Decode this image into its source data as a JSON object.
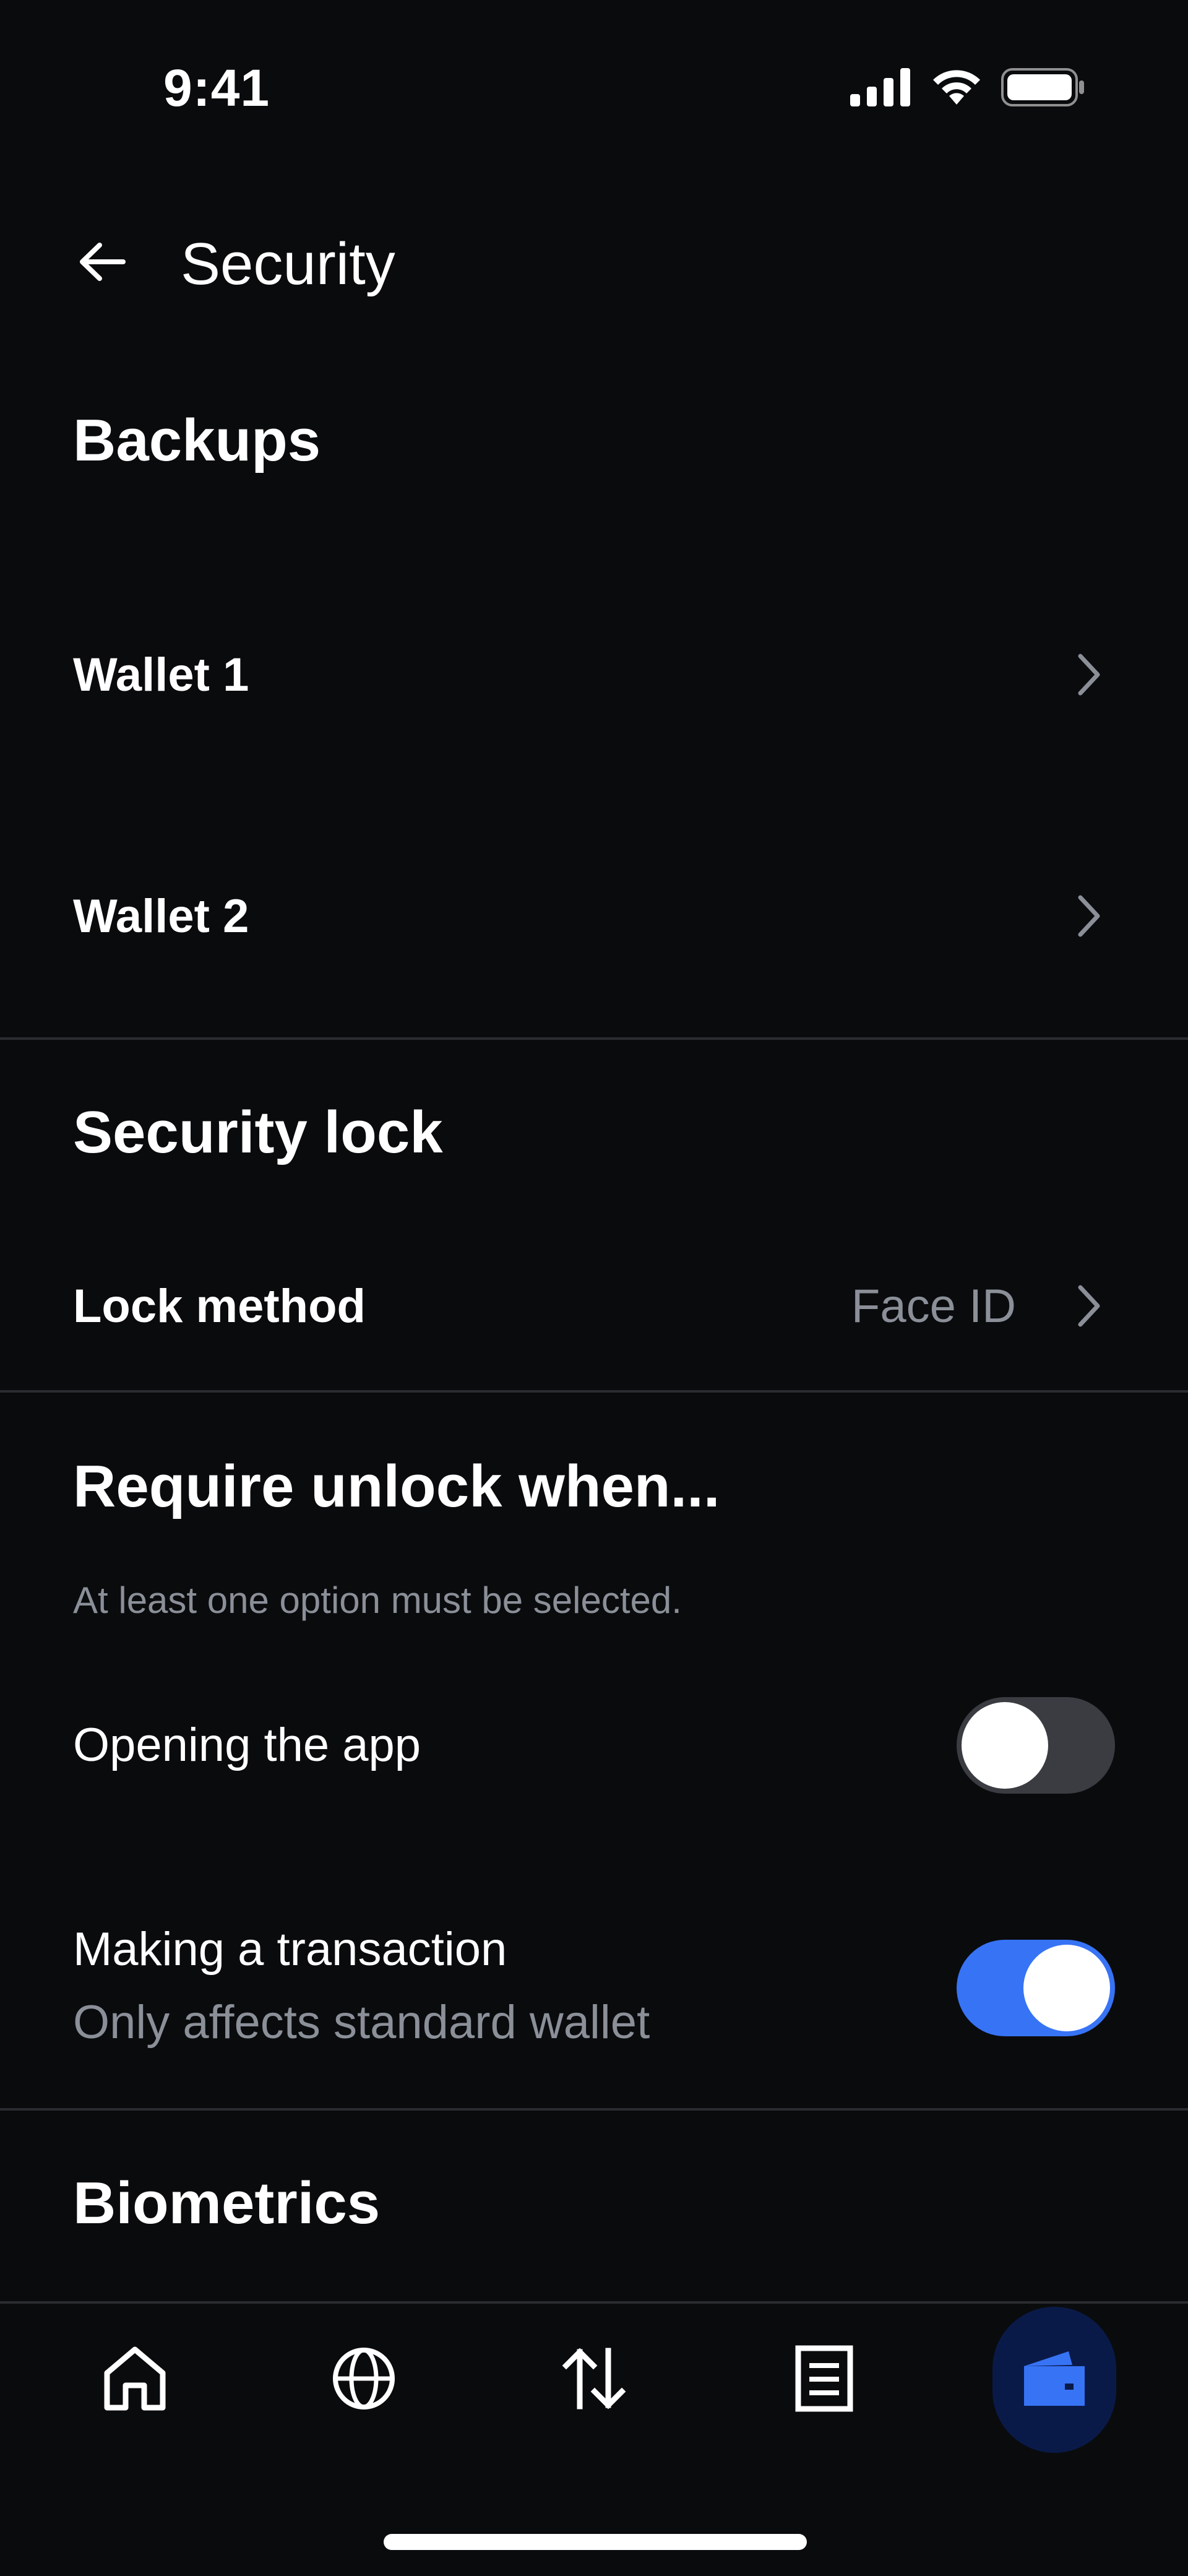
{
  "status_bar": {
    "time": "9:41"
  },
  "header": {
    "title": "Security"
  },
  "backups": {
    "title": "Backups",
    "items": [
      {
        "label": "Wallet 1"
      },
      {
        "label": "Wallet 2"
      }
    ]
  },
  "security_lock": {
    "title": "Security lock",
    "lock_method_label": "Lock method",
    "lock_method_value": "Face ID"
  },
  "require_unlock": {
    "title": "Require unlock when...",
    "helper": "At least one option must be selected.",
    "options": [
      {
        "label": "Opening the app",
        "enabled": false
      },
      {
        "label": "Making a transaction",
        "sublabel": "Only affects standard wallet",
        "enabled": true
      }
    ]
  },
  "biometrics": {
    "title": "Biometrics"
  },
  "bottom_nav": {
    "items": [
      "home-icon",
      "globe-icon",
      "transfer-icon",
      "document-icon",
      "wallet-icon"
    ],
    "active": "wallet-icon"
  },
  "colors": {
    "background": "#0a0b0d",
    "accent": "#3773f5",
    "secondary_text": "#8a8f98",
    "divider": "#2a2c31",
    "active_nav_bg": "#0a1a48"
  }
}
